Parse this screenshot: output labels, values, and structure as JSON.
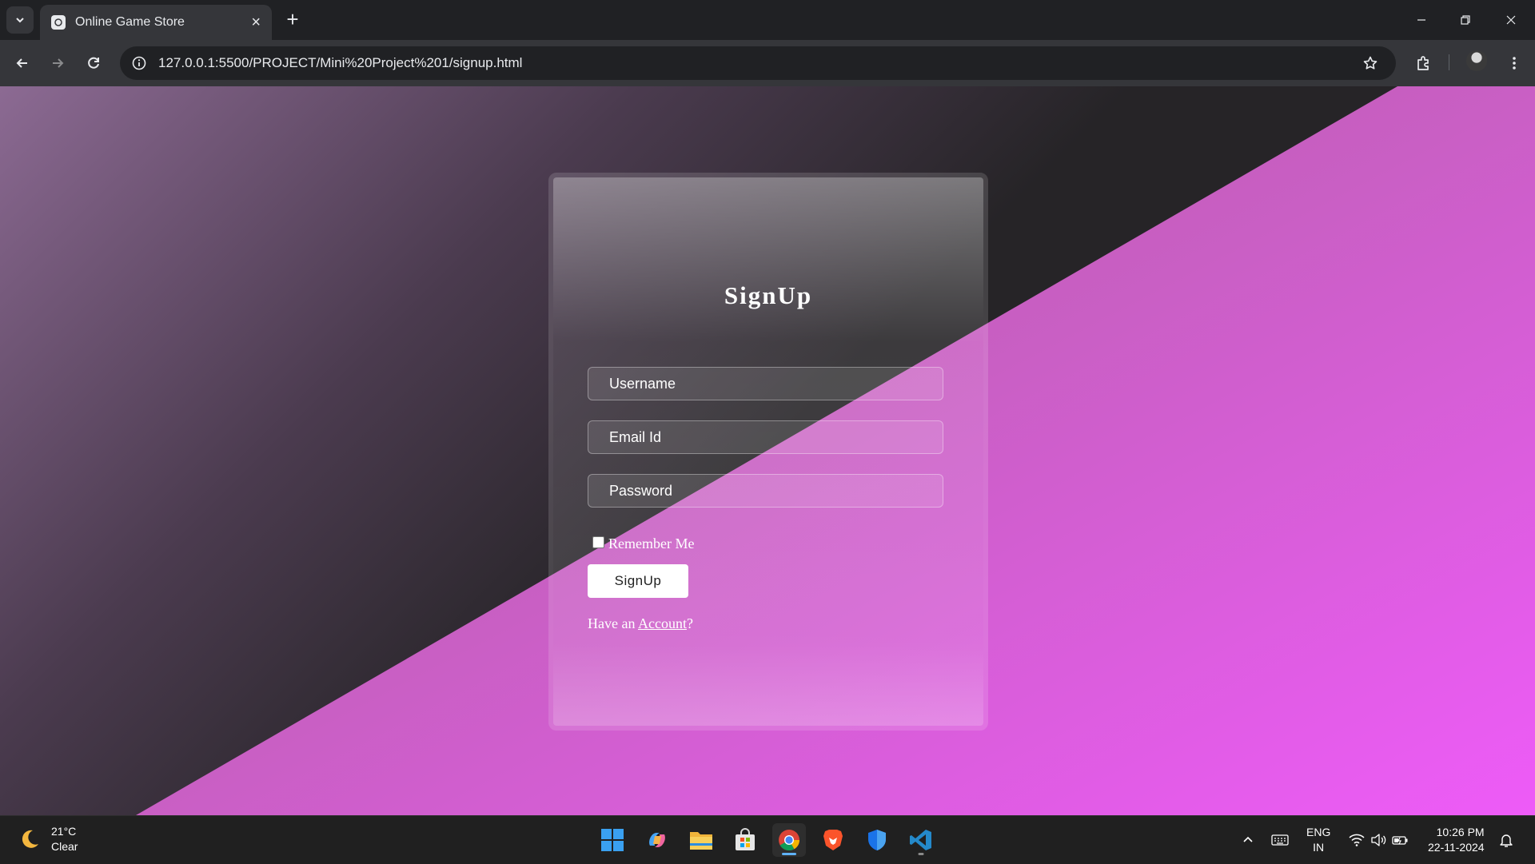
{
  "browser": {
    "tab_title": "Online Game Store",
    "url": "127.0.0.1:5500/PROJECT/Mini%20Project%201/signup.html"
  },
  "page": {
    "title": "SignUp",
    "fields": {
      "username_placeholder": "Username",
      "email_placeholder": "Email Id",
      "password_placeholder": "Password"
    },
    "remember_label": "Remember Me",
    "remember_checked": false,
    "signup_button": "SignUp",
    "account_prefix": "Have an ",
    "account_link": "Account",
    "account_suffix": "?"
  },
  "colors": {
    "accent_pink": "#d259d8",
    "dark_bg": "#262427"
  },
  "taskbar": {
    "weather_temp": "21°C",
    "weather_desc": "Clear",
    "lang_line1": "ENG",
    "lang_line2": "IN",
    "time": "10:26 PM",
    "date": "22-11-2024",
    "apps": [
      "start-icon",
      "copilot-icon",
      "file-explorer-icon",
      "microsoft-store-icon",
      "chrome-icon",
      "brave-icon",
      "defender-icon",
      "vscode-icon"
    ]
  }
}
